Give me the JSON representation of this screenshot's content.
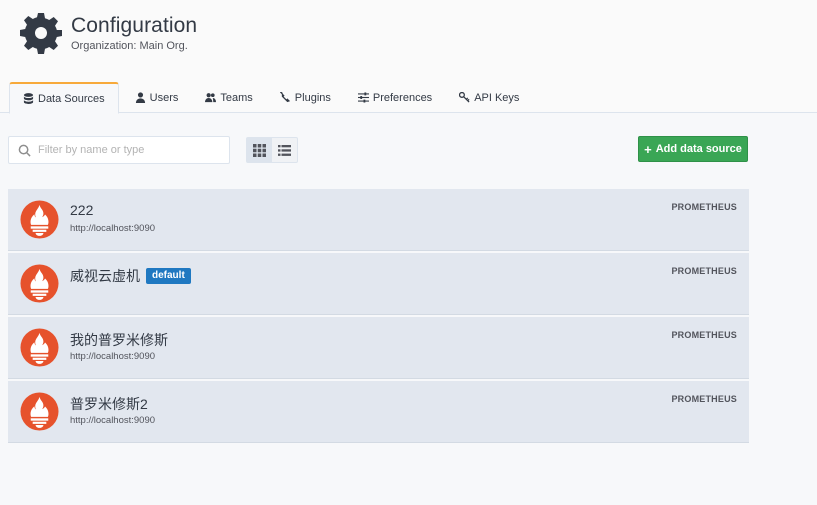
{
  "header": {
    "title": "Configuration",
    "subtitle": "Organization: Main Org."
  },
  "tabs": [
    {
      "label": "Data Sources",
      "icon": "database-icon",
      "active": true
    },
    {
      "label": "Users",
      "icon": "user-icon"
    },
    {
      "label": "Teams",
      "icon": "users-icon"
    },
    {
      "label": "Plugins",
      "icon": "plug-icon"
    },
    {
      "label": "Preferences",
      "icon": "sliders-icon"
    },
    {
      "label": "API Keys",
      "icon": "key-icon"
    }
  ],
  "toolbar": {
    "search_placeholder": "Filter by name or type",
    "search_value": "",
    "add_label": "Add data source",
    "add_icon": "+"
  },
  "datasources": [
    {
      "name": "222",
      "url": "http://localhost:9090",
      "type": "PROMETHEUS",
      "badge": ""
    },
    {
      "name": "威视云虚机",
      "url": "",
      "type": "PROMETHEUS",
      "badge": "default"
    },
    {
      "name": "我的普罗米修斯",
      "url": "http://localhost:9090",
      "type": "PROMETHEUS",
      "badge": ""
    },
    {
      "name": "普罗米修斯2",
      "url": "http://localhost:9090",
      "type": "PROMETHEUS",
      "badge": ""
    }
  ],
  "colors": {
    "accent": "#f7a93a",
    "add_button": "#3aa655",
    "badge": "#1f78c1",
    "prometheus": "#e6522c"
  }
}
